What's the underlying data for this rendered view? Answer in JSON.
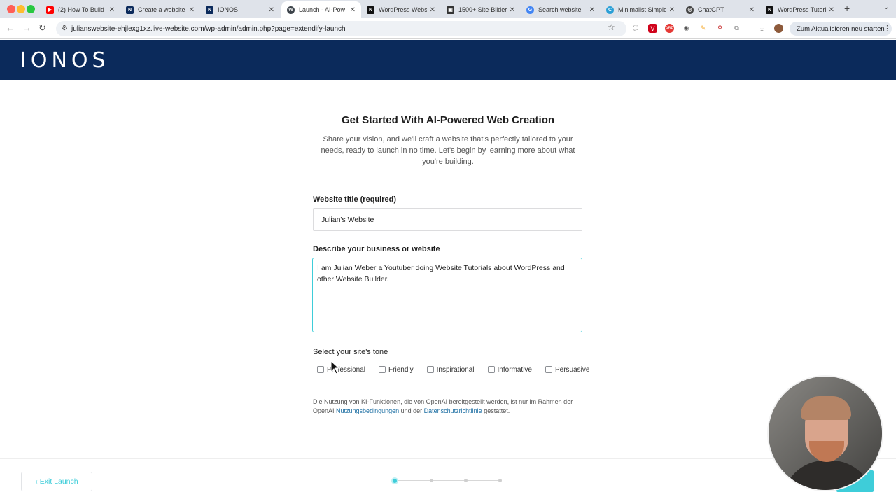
{
  "browser": {
    "tabs": [
      {
        "title": "(2) How To Build",
        "favicon": "youtube-icon",
        "color": "#ff0000"
      },
      {
        "title": "Create a website",
        "favicon": "ionos-icon",
        "color": "#0b2a5b"
      },
      {
        "title": "IONOS",
        "favicon": "ionos-icon",
        "color": "#0b2a5b"
      },
      {
        "title": "Launch - AI-Pow",
        "favicon": "wordpress-icon",
        "color": "#3c434a",
        "active": true
      },
      {
        "title": "WordPress Websi",
        "favicon": "notion-icon",
        "color": "#111111"
      },
      {
        "title": "1500+ Site-Bilder",
        "favicon": "image-icon",
        "color": "#333333"
      },
      {
        "title": "Search website",
        "favicon": "google-icon",
        "color": "#4285f4"
      },
      {
        "title": "Minimalist Simple",
        "favicon": "canva-icon",
        "color": "#2a9fd6"
      },
      {
        "title": "ChatGPT",
        "favicon": "chatgpt-icon",
        "color": "#444444"
      },
      {
        "title": "WordPress Tutori",
        "favicon": "notion-icon",
        "color": "#111111"
      }
    ],
    "url": "julianswebsite-ehjlexg1xz.live-website.com/wp-admin/admin.php?page=extendify-launch",
    "update_button": "Zum Aktualisieren neu starten"
  },
  "header": {
    "logo": "IONOS"
  },
  "main": {
    "title": "Get Started With AI-Powered Web Creation",
    "subtitle": "Share your vision, and we'll craft a website that's perfectly tailored to your needs, ready to launch in no time. Let's begin by learning more about what you're building.",
    "website_title_label": "Website title (required)",
    "website_title_value": "Julian's Website",
    "description_label": "Describe your business or website",
    "description_value": "I am Julian Weber a Youtuber doing Website Tutorials about WordPress and other Website Builder.",
    "tone_label": "Select your site's tone",
    "tones": [
      "Professional",
      "Friendly",
      "Inspirational",
      "Informative",
      "Persuasive"
    ],
    "legal": {
      "prefix": "Die Nutzung von KI-Funktionen, die von OpenAI bereitgestellt werden, ist nur im Rahmen der OpenAI ",
      "link1": "Nutzungsbedingungen",
      "middle": " und der ",
      "link2": "Datenschutzrichtlinie",
      "suffix": " gestattet."
    }
  },
  "footer": {
    "exit_label": "Exit Launch",
    "steps_total": 4,
    "step_current": 1
  },
  "colors": {
    "brand_navy": "#0b2a5b",
    "accent_teal": "#3ecdd9",
    "link_blue": "#1d6fa3"
  }
}
